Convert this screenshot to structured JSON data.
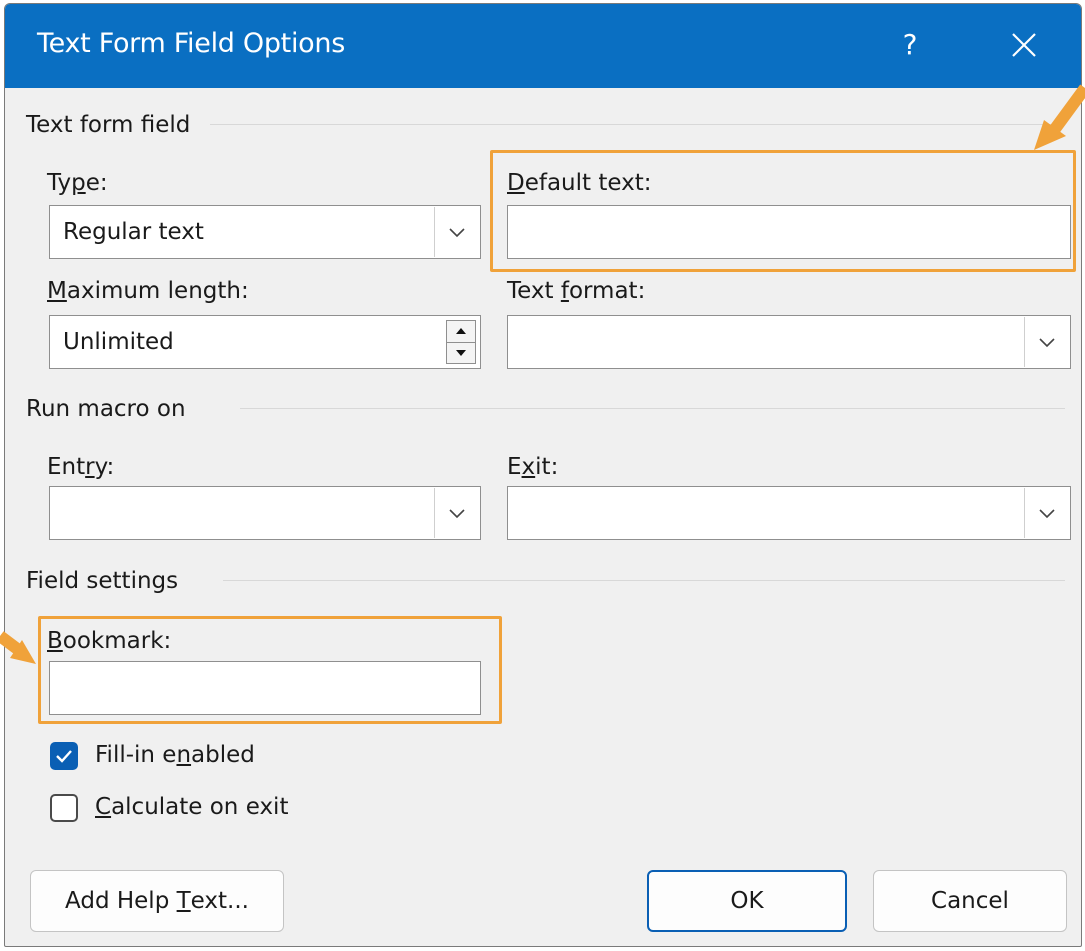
{
  "window": {
    "title": "Text Form Field Options",
    "help_label": "?",
    "close_icon": "close-icon"
  },
  "text_form_field": {
    "group_label": "Text form field",
    "type": {
      "label_pre": "Ty",
      "label_u": "p",
      "label_post": "e:",
      "value": "Regular text"
    },
    "default_text": {
      "label_pre": "",
      "label_u": "D",
      "label_post": "efault text:",
      "value": ""
    },
    "maximum_length": {
      "label_pre": "",
      "label_u": "M",
      "label_post": "aximum length:",
      "value": "Unlimited"
    },
    "text_format": {
      "label_pre": "Text ",
      "label_u": "f",
      "label_post": "ormat:",
      "value": ""
    }
  },
  "run_macro_on": {
    "group_label": "Run macro on",
    "entry": {
      "label_pre": "Ent",
      "label_u": "r",
      "label_post": "y:",
      "value": ""
    },
    "exit": {
      "label_pre": "E",
      "label_u": "x",
      "label_post": "it:",
      "value": ""
    }
  },
  "field_settings": {
    "group_label": "Field settings",
    "bookmark": {
      "label_pre": "",
      "label_u": "B",
      "label_post": "ookmark:",
      "value": ""
    },
    "fill_in_enabled": {
      "label_pre": "Fill-in e",
      "label_u": "n",
      "label_post": "abled",
      "checked": true
    },
    "calculate_on_exit": {
      "label_pre": "",
      "label_u": "C",
      "label_post": "alculate on exit",
      "checked": false
    }
  },
  "buttons": {
    "add_help_text": {
      "label_pre": "Add Help ",
      "label_u": "T",
      "label_post": "ext..."
    },
    "ok": "OK",
    "cancel": "Cancel"
  },
  "colors": {
    "titlebar": "#0a6fc2",
    "highlight": "#f0a23a",
    "checkbox_checked": "#0a5fb4"
  }
}
